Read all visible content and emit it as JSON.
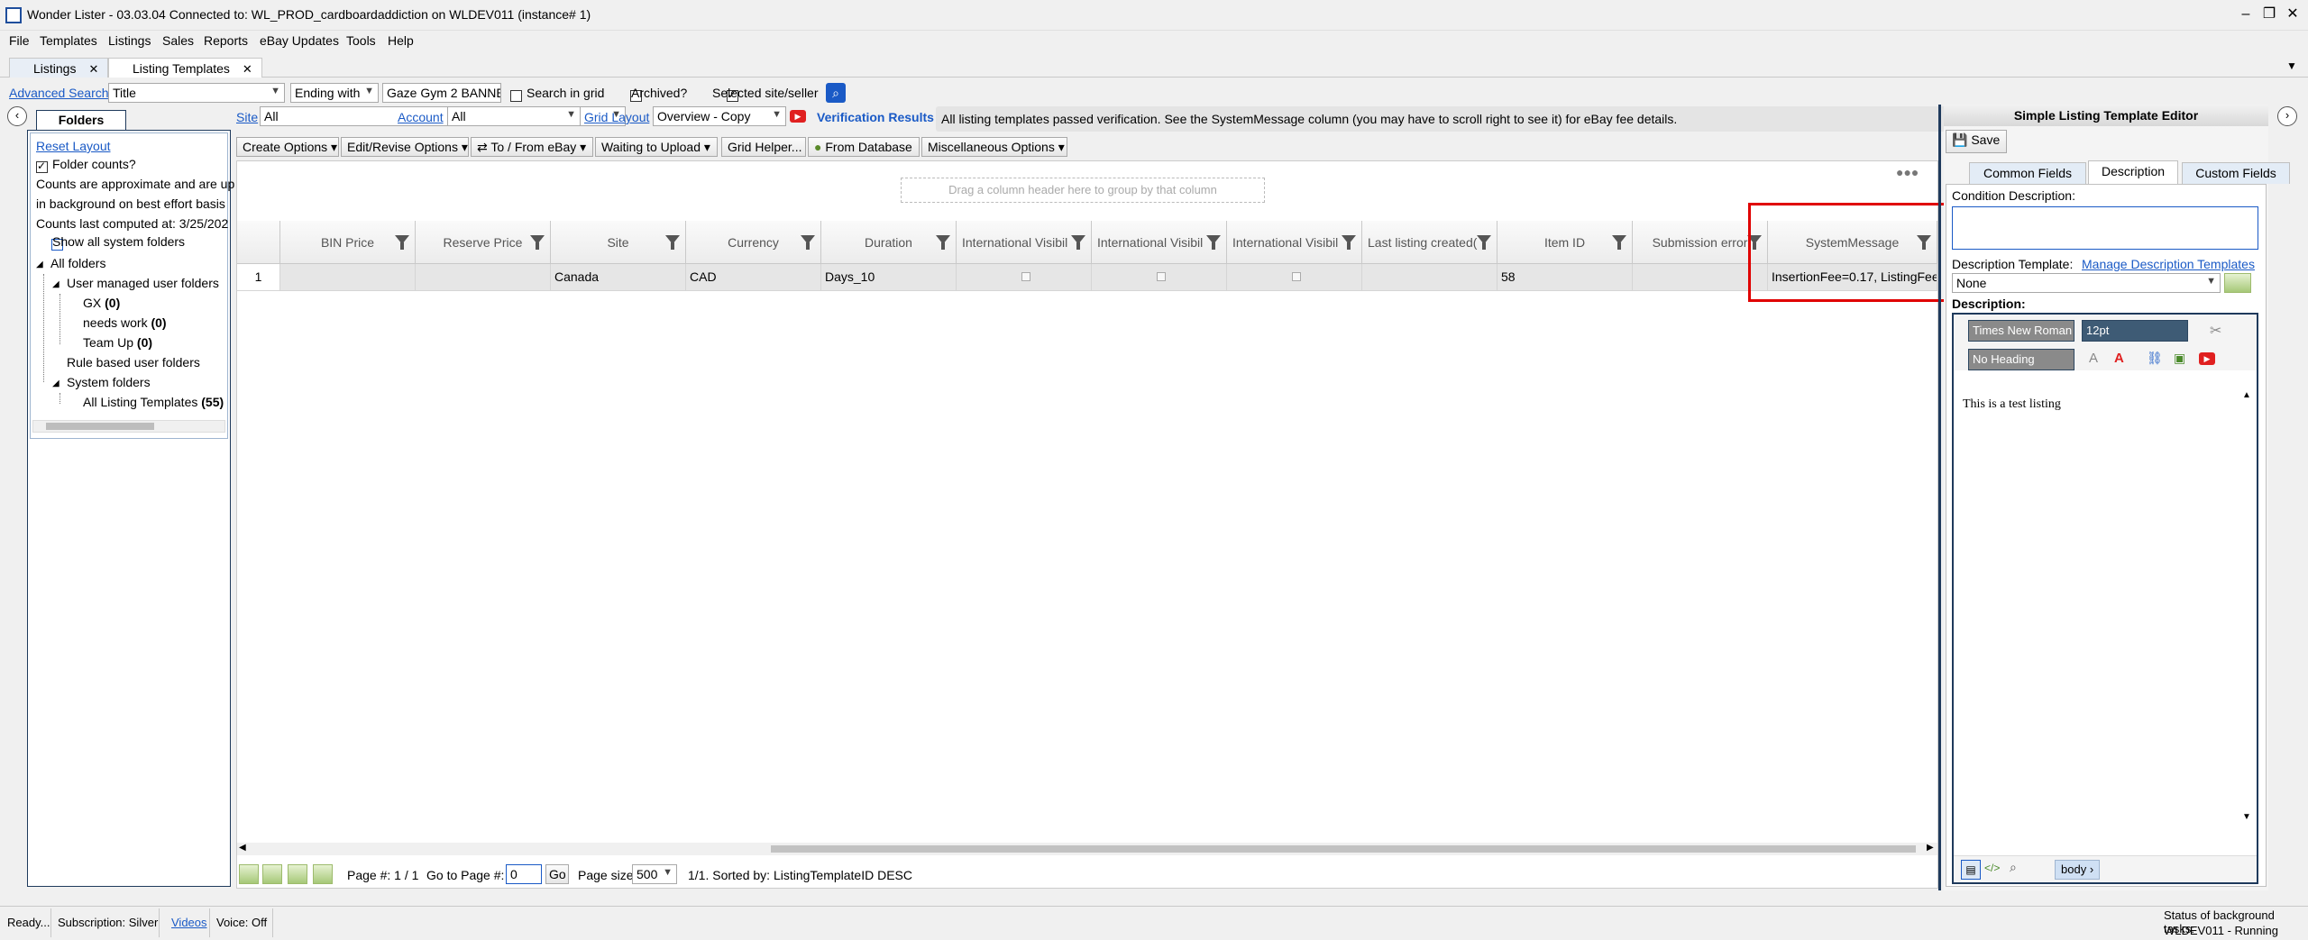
{
  "window": {
    "title": "Wonder Lister - 03.03.04 Connected to: WL_PROD_cardboardaddiction on WLDEV011 (instance# 1)"
  },
  "menu": [
    "File",
    "Templates",
    "Listings",
    "Sales",
    "Reports",
    "eBay Updates",
    "Tools",
    "Help"
  ],
  "tabs": [
    {
      "label": "Listings",
      "close": "✕"
    },
    {
      "label": "Listing Templates",
      "close": "✕"
    }
  ],
  "search": {
    "advanced_link": "Advanced Search",
    "field": "Title",
    "operator": "Ending with",
    "value": "Gaze Gym 2 BANNER",
    "search_in_grid": "Search in grid",
    "archived": "Archived?",
    "selected_site_seller": "Selected site/seller"
  },
  "folders": {
    "tab_label": "Folders",
    "reset_layout": "Reset Layout",
    "folder_counts": "Folder counts?",
    "note_line1": "Counts are approximate and are up",
    "note_line2": "in background on best effort basis",
    "note_line3": "Counts last computed at: 3/25/202",
    "show_all_system": "Show all system folders",
    "all_folders": "All folders",
    "user_managed": "User managed user folders",
    "gx": "GX",
    "gx_count": "(0)",
    "needs_work": "needs work",
    "needs_work_count": "(0)",
    "team_up": "Team Up",
    "team_up_count": "(0)",
    "rule_based": "Rule based user folders",
    "system_folders": "System folders",
    "all_listing_templates": "All Listing Templates",
    "all_listing_templates_count": "(55)"
  },
  "filterbar": {
    "site_label": "Site",
    "site_value": "All",
    "account_label": "Account",
    "account_value": "All",
    "grid_layout_label": "Grid Layout",
    "grid_layout_value": "Overview - Copy",
    "verification_label": "Verification Results",
    "verification_message": "All listing templates passed verification. See the SystemMessage column (you may have to scroll right to see it) for eBay fee details."
  },
  "toolbar": {
    "create_options": "Create Options",
    "edit_revise": "Edit/Revise Options",
    "to_from_ebay": "To / From eBay",
    "waiting_upload": "Waiting to Upload",
    "grid_helper": "Grid Helper...",
    "from_database": "From Database",
    "misc_options": "Miscellaneous Options"
  },
  "grid": {
    "group_hint": "Drag a column header here to group by that column",
    "columns": [
      "BIN Price",
      "Reserve Price",
      "Site",
      "Currency",
      "Duration",
      "International Visibil",
      "International Visibil",
      "International Visibil",
      "Last listing created(",
      "Item ID",
      "Submission error",
      "SystemMessage"
    ],
    "row": {
      "num": "1",
      "bin_price": "",
      "reserve_price": "",
      "site": "Canada",
      "currency": "CAD",
      "duration": "Days_10",
      "last_listing": "",
      "item_id": "58",
      "submission_error": "",
      "system_message": "InsertionFee=0.17, ListingFee=0"
    }
  },
  "pager": {
    "page_label": "Page #: 1 / 1",
    "goto_label": "Go to Page #:",
    "goto_value": "0",
    "go_button": "Go",
    "page_size_label": "Page size:",
    "page_size_value": "500",
    "summary": "1/1. Sorted by: ListingTemplateID DESC"
  },
  "editor": {
    "title": "Simple Listing Template Editor",
    "save": "Save",
    "tab_common": "Common Fields",
    "tab_description": "Description",
    "tab_custom": "Custom Fields",
    "condition_label": "Condition Description:",
    "desc_template_label": "Description Template:",
    "manage_link": "Manage Description Templates",
    "template_value": "None",
    "description_label": "Description:",
    "font_value": "Times New Roman",
    "size_value": "12pt",
    "heading_value": "No Heading",
    "body_text": "This is a test listing",
    "breadcrumb": "body"
  },
  "status": {
    "ready": "Ready...",
    "subscription": "Subscription: Silver",
    "videos": "Videos",
    "voice": "Voice:  Off",
    "bg_label": "Status of background tasks:",
    "bg_value": "WLDEV011 - Running"
  },
  "colors": {
    "accent": "#1a5ac6",
    "panel_border": "#1f3a5c",
    "highlight_box": "#e00000"
  }
}
